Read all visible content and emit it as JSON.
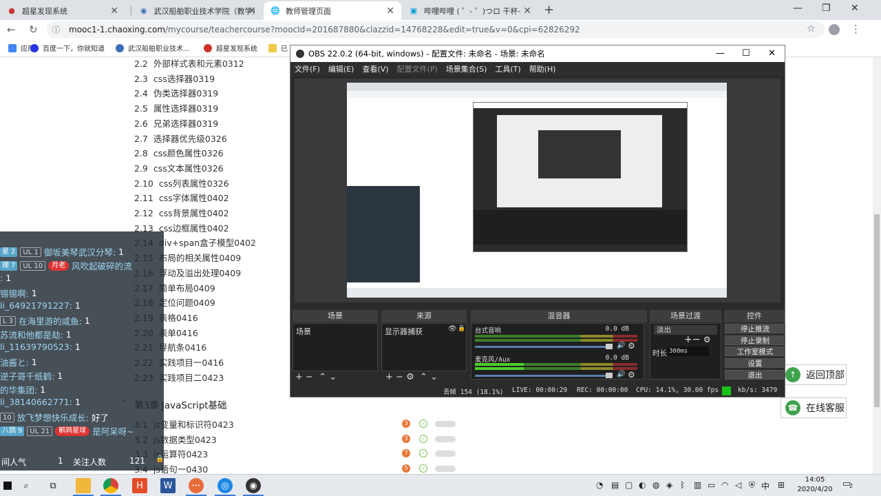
{
  "browser": {
    "tabs": [
      {
        "title": "超星发现系统",
        "active": false
      },
      {
        "title": "武汉船舶职业技术学院（教学）",
        "active": false
      },
      {
        "title": "教师管理页面",
        "active": true
      },
      {
        "title": "哔哩哔哩 ( ゜- ゜)つロ 干杯~-bili",
        "active": false
      }
    ],
    "new_tab": "+",
    "url_host": "mooc1-1.chaoxing.com",
    "url_path": "/mycourse/teachercourse?moocId=201687880&clazzid=14768228&edit=true&v=0&cpi=62826292",
    "bookmarks": [
      {
        "label": "应用",
        "color": "#4285f4"
      },
      {
        "label": "百度一下，你就知道",
        "color": "#2932e1"
      },
      {
        "label": "武汉船舶职业技术...",
        "color": "#3b6db4"
      },
      {
        "label": "超星发现系统",
        "color": "#d0322b"
      },
      {
        "label": "已",
        "color": "#f2c94c"
      }
    ]
  },
  "course": {
    "items": [
      {
        "num": "2.2",
        "title": "外部样式表和元素0312"
      },
      {
        "num": "2.3",
        "title": "css选择器0319"
      },
      {
        "num": "2.4",
        "title": "伪类选择器0319"
      },
      {
        "num": "2.5",
        "title": "属性选择器0319"
      },
      {
        "num": "2.6",
        "title": "兄弟选择器0319"
      },
      {
        "num": "2.7",
        "title": "选择器优先级0326"
      },
      {
        "num": "2.8",
        "title": "css颜色属性0326"
      },
      {
        "num": "2.9",
        "title": "css文本属性0326"
      },
      {
        "num": "2.10",
        "title": "css列表属性0326"
      },
      {
        "num": "2.11",
        "title": "css字体属性0402"
      },
      {
        "num": "2.12",
        "title": "css背景属性0402"
      },
      {
        "num": "2.13",
        "title": "css边框属性0402"
      },
      {
        "num": "2.14",
        "title": "div+span盒子模型0402"
      },
      {
        "num": "2.15",
        "title": "布局的相关属性0409"
      },
      {
        "num": "2.16",
        "title": "浮动及溢出处理0409"
      },
      {
        "num": "2.17",
        "title": "简单布局0409"
      },
      {
        "num": "2.18",
        "title": "定位问题0409"
      },
      {
        "num": "2.19",
        "title": "表格0416"
      },
      {
        "num": "2.20",
        "title": "表单0416"
      },
      {
        "num": "2.21",
        "title": "导航条0416"
      },
      {
        "num": "2.22",
        "title": "实践项目一0416"
      },
      {
        "num": "2.23",
        "title": "实践项目二0423"
      }
    ],
    "chapter3_title": "第3章 JavaScript基础",
    "chapter3_items": [
      {
        "num": "3.1",
        "title": "js变量和标识符0423",
        "badge": "3",
        "badge_color": "#e8773a"
      },
      {
        "num": "3.2",
        "title": "js数据类型0423",
        "badge": "3",
        "badge_color": "#e8773a"
      },
      {
        "num": "3.3",
        "title": "js运算符0423",
        "badge": "7",
        "badge_color": "#e8773a"
      },
      {
        "num": "3.4",
        "title": "js语句一0430",
        "badge": "5",
        "badge_color": "#e8773a"
      }
    ],
    "back_to_top": "返回顶部",
    "online_service": "在线客服"
  },
  "danmaku": {
    "lines": [
      {
        "badge1": "星",
        "badge1_n": "2",
        "ul": "UL 1",
        "name": "御坂美琴武汉分琴:",
        "msg": "1"
      },
      {
        "badge1": "理",
        "badge1_n": "7",
        "ul": "UL 10",
        "medal": "月老",
        "name": "",
        "msg": "风吹起破碎的流"
      },
      {
        "name": ":",
        "msg": "1"
      },
      {
        "name": "锡锡啊:",
        "msg": "1"
      },
      {
        "name": "li_64921791227:",
        "msg": "1"
      },
      {
        "ul": "L 3",
        "name": "在海里游的咸鱼:",
        "msg": "1"
      },
      {
        "name": "苏流和他都是劫:",
        "msg": "1"
      },
      {
        "name": "li_11639790523:",
        "msg": "1"
      },
      {
        "name": "油酱と:",
        "msg": "1"
      },
      {
        "name": "逆子哥千纸鹤:",
        "msg": "1"
      },
      {
        "name": "的华集团:",
        "msg": "1"
      },
      {
        "name": "li_38140662771:",
        "msg": "1"
      },
      {
        "ul": "10",
        "name": "放飞梦想快乐成长:",
        "msg": "好了"
      },
      {
        "badge1": "八鸽",
        "badge1_n": "9",
        "ul": "UL 21",
        "medal": "鹌鹑星球",
        "name": "",
        "msg": "是阿呆呀~"
      }
    ],
    "footer_popularity_label": "间人气",
    "footer_popularity": "1",
    "footer_followers_label": "关注人数",
    "footer_followers": "121"
  },
  "obs": {
    "title": "OBS 22.0.2 (64-bit, windows) - 配置文件: 未命名 - 场景: 未命名",
    "menu": [
      "文件(F)",
      "编辑(E)",
      "查看(V)",
      "配置文件(P)",
      "场景集合(S)",
      "工具(T)",
      "帮助(H)"
    ],
    "dock_titles": [
      "场景",
      "来源",
      "混音器",
      "场景过渡",
      "控件"
    ],
    "scene": "场景",
    "source": "显示器捕获",
    "mixer": [
      {
        "name": "台式音响",
        "db": "0.0 dB"
      },
      {
        "name": "麦克风/Aux",
        "db": "0.0 dB"
      }
    ],
    "transition": "淡出",
    "duration_label": "时长",
    "duration": "300ms",
    "controls": [
      "停止推流",
      "停止录制",
      "工作室模式",
      "设置",
      "退出"
    ],
    "status": {
      "dropped": "丢帧 154 (18.1%)",
      "live": "LIVE: 00:00:29",
      "rec": "REC: 00:00:00",
      "cpu": "CPU: 14.1%, 30.00 fps",
      "kbs": "kb/s: 3479"
    }
  },
  "taskbar": {
    "time": "14:05",
    "date": "2020/4/20",
    "ime": "中",
    "notif": "2"
  }
}
